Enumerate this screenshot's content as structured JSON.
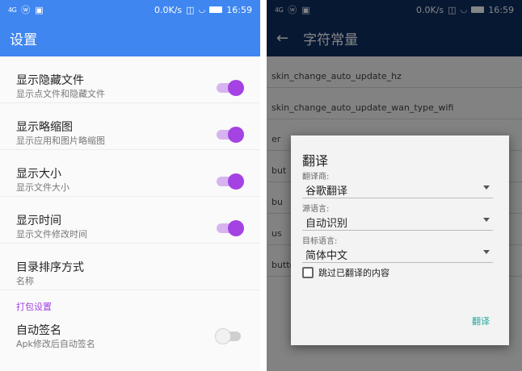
{
  "left_screen": {
    "status": {
      "signal": "4G",
      "wechat": "ⓦ",
      "speed": "0.0K/s",
      "time": "16:59"
    },
    "title": "设置",
    "settings": [
      {
        "title": "显示隐藏文件",
        "subtitle": "显示点文件和隐藏文件",
        "toggle": true
      },
      {
        "title": "显示略缩图",
        "subtitle": "显示应用和图片略缩图",
        "toggle": true
      },
      {
        "title": "显示大小",
        "subtitle": "显示文件大小",
        "toggle": true
      },
      {
        "title": "显示时间",
        "subtitle": "显示文件修改时间",
        "toggle": true
      },
      {
        "title": "目录排序方式",
        "subtitle": "名称"
      }
    ],
    "section_header": "打包设置",
    "signing": {
      "title": "自动签名",
      "subtitle": "Apk修改后自动签名",
      "toggle": false
    }
  },
  "right_screen": {
    "status": {
      "signal": "4G",
      "wechat": "ⓦ",
      "speed": "0.0K/s",
      "time": "16:59"
    },
    "title": "字符常量",
    "background_items": [
      "skin_change_auto_update_hz",
      "skin_change_auto_update_wan_type_wifi",
      "er",
      "but",
      "bu",
      "us",
      "button_text_cancel_download"
    ],
    "dialog": {
      "title": "翻译",
      "provider_label": "翻译商:",
      "provider_value": "谷歌翻译",
      "source_label": "源语言:",
      "source_value": "自动识别",
      "target_label": "目标语言:",
      "target_value": "简体中文",
      "skip_label": "跳过已翻译的内容",
      "skip_checked": false,
      "translate_button": "翻译"
    }
  },
  "colors": {
    "left_appbar": "#3f86f0",
    "right_appbar": "#0e2f62",
    "accent_purple": "#a442e3",
    "button_teal": "#26a69a"
  }
}
